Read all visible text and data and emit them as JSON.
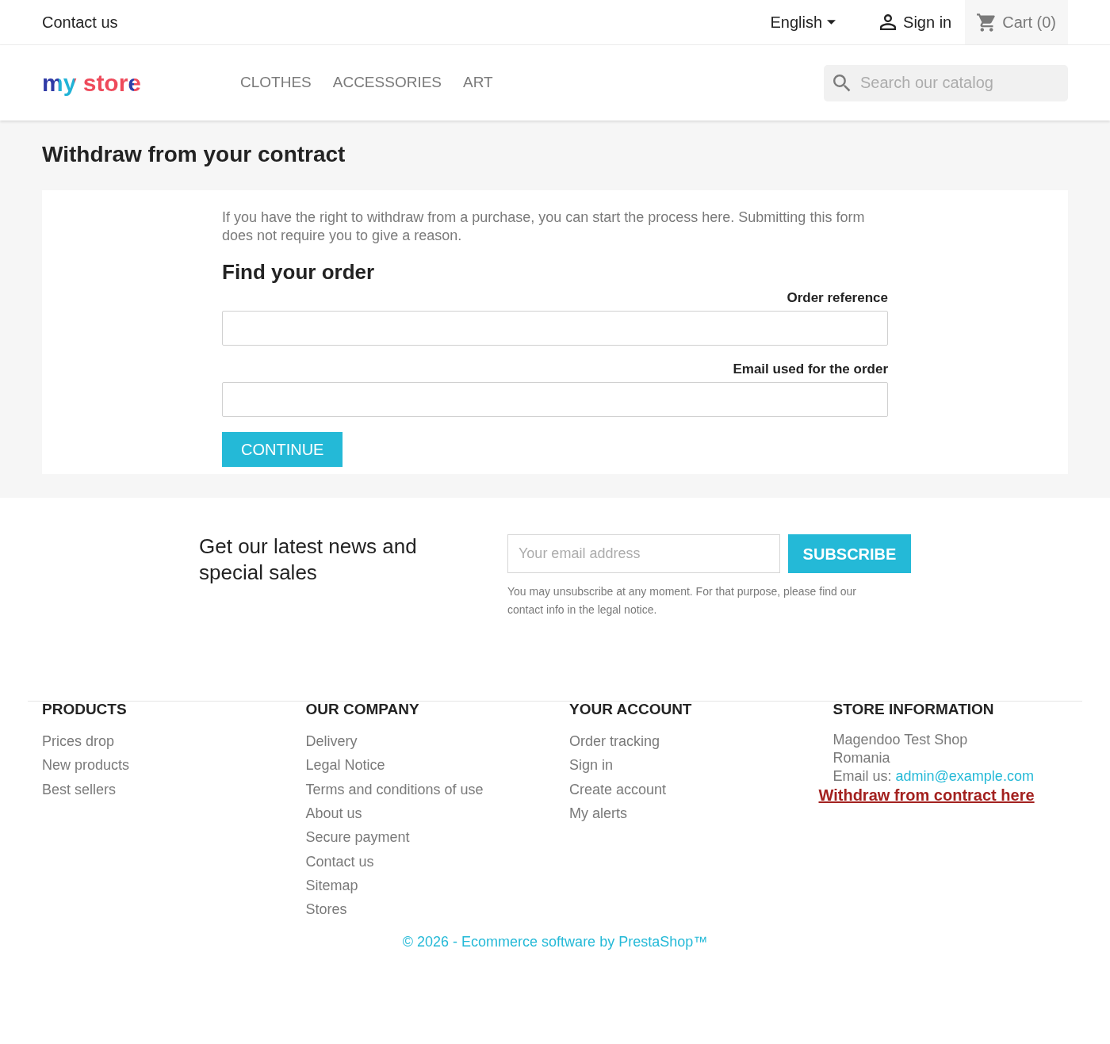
{
  "top_bar": {
    "contact_link": "Contact us",
    "language": "English",
    "sign_in": "Sign in",
    "cart": "Cart (0)"
  },
  "header": {
    "logo": "my store",
    "menu": [
      {
        "label": "CLOTHES"
      },
      {
        "label": "ACCESSORIES"
      },
      {
        "label": "ART"
      }
    ],
    "search": {
      "placeholder": "Search our catalog"
    }
  },
  "page": {
    "title": "Withdraw from your contract",
    "intro": "If you have the right to withdraw from a purchase, you can start the process here. Submitting this form does not require you to give a reason.",
    "form": {
      "heading": "Find your order",
      "fields": [
        {
          "label": "Order reference"
        },
        {
          "label": "Email used for the order"
        }
      ],
      "button": "CONTINUE"
    }
  },
  "newsletter": {
    "heading": "Get our latest news and special sales",
    "email": {
      "placeholder": "Your email address"
    },
    "button": "SUBSCRIBE",
    "note": "You may unsubscribe at any moment. For that purpose, please find our contact info in the legal notice."
  },
  "footer": {
    "columns": [
      {
        "title": "PRODUCTS",
        "links": [
          "Prices drop",
          "New products",
          "Best sellers"
        ]
      },
      {
        "title": "OUR COMPANY",
        "links": [
          "Delivery",
          "Legal Notice",
          "Terms and conditions of use",
          "About us",
          "Secure payment",
          "Contact us",
          "Sitemap",
          "Stores"
        ]
      },
      {
        "title": "YOUR ACCOUNT",
        "links": [
          "Order tracking",
          "Sign in",
          "Create account",
          "My alerts"
        ]
      }
    ],
    "store_info": {
      "title": "STORE INFORMATION",
      "lines": [
        "Magendoo Test Shop",
        "Romania"
      ],
      "email_label": "Email us:",
      "email": "admin@example.com",
      "withdraw_link": "Withdraw from contract here"
    },
    "copyright": "© 2026 - Ecommerce software by PrestaShop™"
  }
}
